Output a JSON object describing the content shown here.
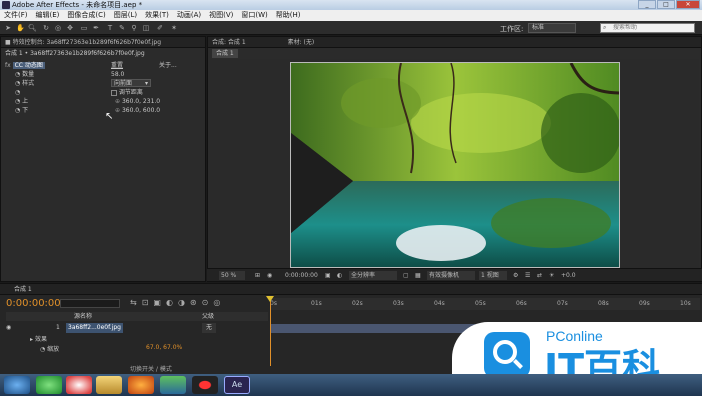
{
  "window": {
    "title": "Adobe After Effects - 未命名项目.aep *"
  },
  "menu": [
    "文件(F)",
    "编辑(E)",
    "图像合成(C)",
    "图层(L)",
    "效果(T)",
    "动画(A)",
    "视图(V)",
    "窗口(W)",
    "帮助(H)"
  ],
  "toolbar": {
    "workspace_label": "工作区:",
    "workspace_value": "标准",
    "search_placeholder": "搜索帮助"
  },
  "effects_panel": {
    "tab": "■ 特效控制台: 3a68ff27363e1b289f6f626b7f0e0f.jpg",
    "subtitle": "合成 1 • 3a68ff27363e1b289f6f626b7f0e0f.jpg",
    "effect_name": "CC 动态图",
    "reset": "重置",
    "about": "关于...",
    "params": [
      {
        "name": "数量",
        "value": "58.0"
      },
      {
        "name": "样式",
        "value": "向前面"
      },
      {
        "name": "",
        "value": "调节距离"
      },
      {
        "name": "上",
        "value": "360.0, 231.0"
      },
      {
        "name": "下",
        "value": "360.0, 600.0"
      }
    ]
  },
  "viewer": {
    "tab": "合成: 合成 1",
    "tab2": "素材: (无)",
    "subtab": "合成 1",
    "zoom": "50 %",
    "timecode": "0:00:00:00",
    "resolution": "全分辨率",
    "camera": "有效摄像机",
    "views": "1 视图",
    "exposure": "+0.0"
  },
  "timeline": {
    "tab": "合成 1",
    "timecode": "0:00:00:00",
    "col_name": "源名称",
    "col_parent": "父级",
    "layer_num": "1",
    "layer_name": "3a68ff2...0e0f.jpg",
    "parent_value": "无",
    "effects_label": "效果",
    "scale_label": "缩放",
    "scale_value": "67.0, 67.0%",
    "toggle_label": "切换开关 / 模式",
    "ruler": [
      "0s",
      "01s",
      "02s",
      "03s",
      "04s",
      "05s",
      "06s",
      "07s",
      "08s",
      "09s",
      "10s"
    ]
  },
  "watermark": {
    "brand": "PConline",
    "text": "IT百科"
  },
  "taskbar": {
    "items": [
      "start",
      "browser-green",
      "qq",
      "folder",
      "firefox",
      "media",
      "record",
      "ae"
    ]
  }
}
